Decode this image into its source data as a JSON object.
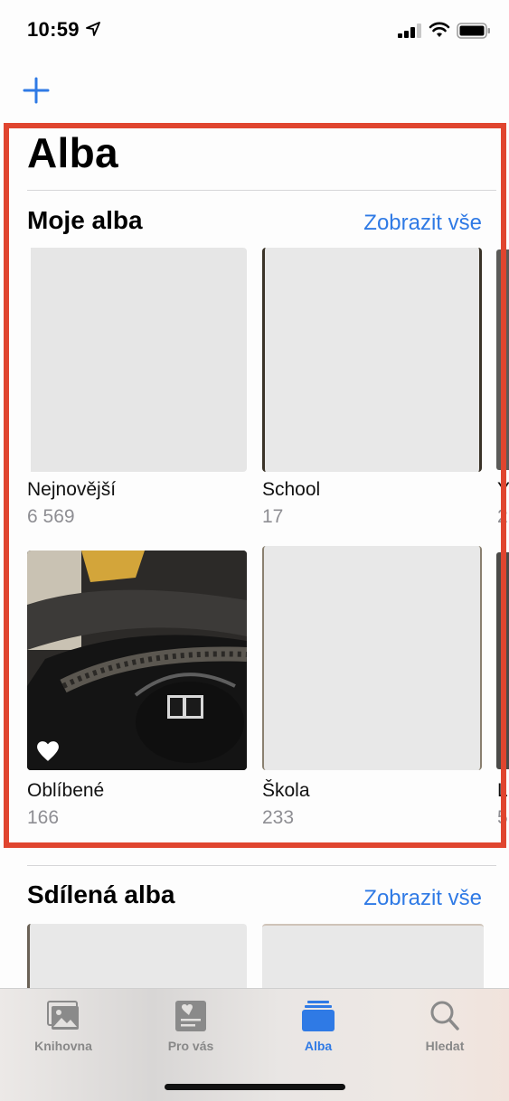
{
  "status": {
    "time": "10:59"
  },
  "page": {
    "title": "Alba"
  },
  "my_albums": {
    "title": "Moje alba",
    "see_all": "Zobrazit vše",
    "albums": [
      {
        "name": "Nejnovější",
        "count": "6 569"
      },
      {
        "name": "School",
        "count": "17"
      },
      {
        "name": "Oblíbené",
        "count": "166"
      },
      {
        "name": "Škola",
        "count": "233"
      }
    ],
    "partial_next": {
      "name_initial_top": "Y",
      "count_initial_top": "2",
      "name_initial_bottom": "L",
      "count_initial_bottom": "5"
    }
  },
  "shared_albums": {
    "title": "Sdílená alba",
    "see_all": "Zobrazit vše"
  },
  "tabs": [
    {
      "label": "Knihovna",
      "icon": "photos-library-icon"
    },
    {
      "label": "Pro vás",
      "icon": "for-you-icon"
    },
    {
      "label": "Alba",
      "icon": "albums-icon",
      "active": true
    },
    {
      "label": "Hledat",
      "icon": "search-icon"
    }
  ],
  "colors": {
    "accent": "#2f7ae5",
    "highlight": "#e0452f",
    "secondary_text": "#8e8e93"
  }
}
